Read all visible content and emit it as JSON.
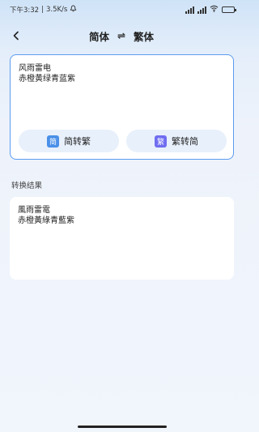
{
  "status": {
    "time": "下午3:32",
    "network_speed": "3.5K/s",
    "battery_level": 0.85
  },
  "header": {
    "source_lang": "简体",
    "swap_symbol": "⇌",
    "target_lang": "繁体"
  },
  "input": {
    "text": "风雨雷电\n赤橙黄绿青蓝紫"
  },
  "actions": {
    "to_traditional": {
      "icon_char": "简",
      "label": "简转繁"
    },
    "to_simplified": {
      "icon_char": "繁",
      "label": "繁转简"
    }
  },
  "result": {
    "label": "转换结果",
    "text": "風雨雷電\n赤橙黃綠青藍紫"
  },
  "colors": {
    "accent": "#5b9bf0",
    "button_bg": "#e8f0fb",
    "icon_blue": "#4a90e8",
    "icon_purple": "#6f6df0"
  }
}
